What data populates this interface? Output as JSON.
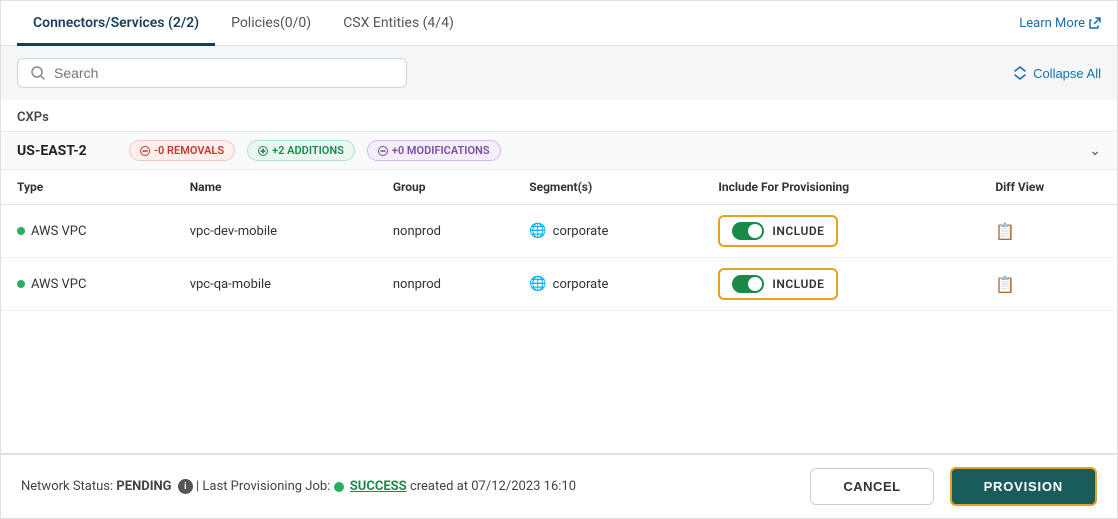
{
  "tabs": [
    {
      "id": "connectors",
      "label": "Connectors/Services (2/2)",
      "active": true
    },
    {
      "id": "policies",
      "label": "Policies(0/0)",
      "active": false
    },
    {
      "id": "csx",
      "label": "CSX Entities (4/4)",
      "active": false
    }
  ],
  "learn_more": "Learn More",
  "search": {
    "placeholder": "Search"
  },
  "collapse_all": "Collapse All",
  "cxps_label": "CXPs",
  "region": {
    "name": "US-EAST-2",
    "badges": [
      {
        "id": "removals",
        "label": "-0 REMOVALS",
        "type": "red"
      },
      {
        "id": "additions",
        "label": "+2 ADDITIONS",
        "type": "green"
      },
      {
        "id": "modifications",
        "label": "+0 MODIFICATIONS",
        "type": "purple"
      }
    ]
  },
  "table": {
    "columns": [
      "Type",
      "Name",
      "Group",
      "Segment(s)",
      "Include For Provisioning",
      "Diff View"
    ],
    "rows": [
      {
        "type": "AWS VPC",
        "name": "vpc-dev-mobile",
        "group": "nonprod",
        "segment": "corporate",
        "include": "INCLUDE",
        "included": true
      },
      {
        "type": "AWS VPC",
        "name": "vpc-qa-mobile",
        "group": "nonprod",
        "segment": "corporate",
        "include": "INCLUDE",
        "included": true
      }
    ]
  },
  "footer": {
    "network_status_label": "Network Status:",
    "pending_label": "PENDING",
    "separator": "|",
    "last_job_label": "Last Provisioning Job:",
    "success_label": "SUCCESS",
    "created_at": "created at 07/12/2023 16:10",
    "cancel_label": "CANCEL",
    "provision_label": "PROVISION"
  }
}
